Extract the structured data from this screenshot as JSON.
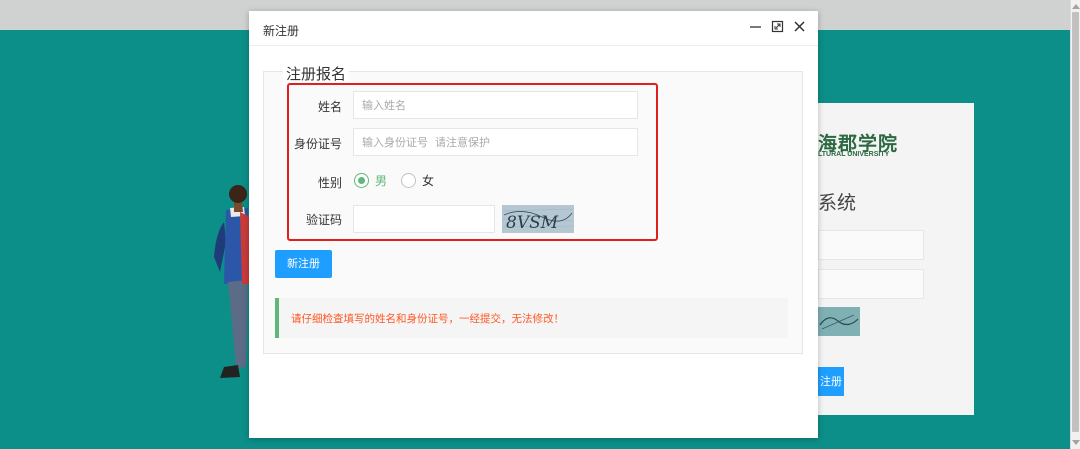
{
  "background": {
    "logo_text": "海郡学院",
    "logo_subtext": "LTURAL UNIVERSITY",
    "system_title": "系统",
    "button_label": "注册"
  },
  "modal": {
    "title": "新注册",
    "legend": "注册报名",
    "fields": {
      "name_label": "姓名",
      "name_placeholder": "输入姓名",
      "id_label": "身份证号",
      "id_placeholder": "输入身份证号  请注意保护",
      "gender_label": "性别",
      "gender_options": [
        "男",
        "女"
      ],
      "gender_selected": "男",
      "captcha_label": "验证码",
      "captcha_value": "",
      "captcha_image_text": "8VSM"
    },
    "submit_label": "新注册",
    "notice": "请仔细检查填写的姓名和身份证号，一经提交，无法修改！"
  },
  "colors": {
    "teal_background": "#0b8f88",
    "primary_button": "#1e9fff",
    "radio_green": "#5fb878",
    "highlight_red": "#e02020",
    "notice_text": "#ff5722"
  },
  "icons": [
    "minimize-icon",
    "maximize-icon",
    "close-icon"
  ]
}
